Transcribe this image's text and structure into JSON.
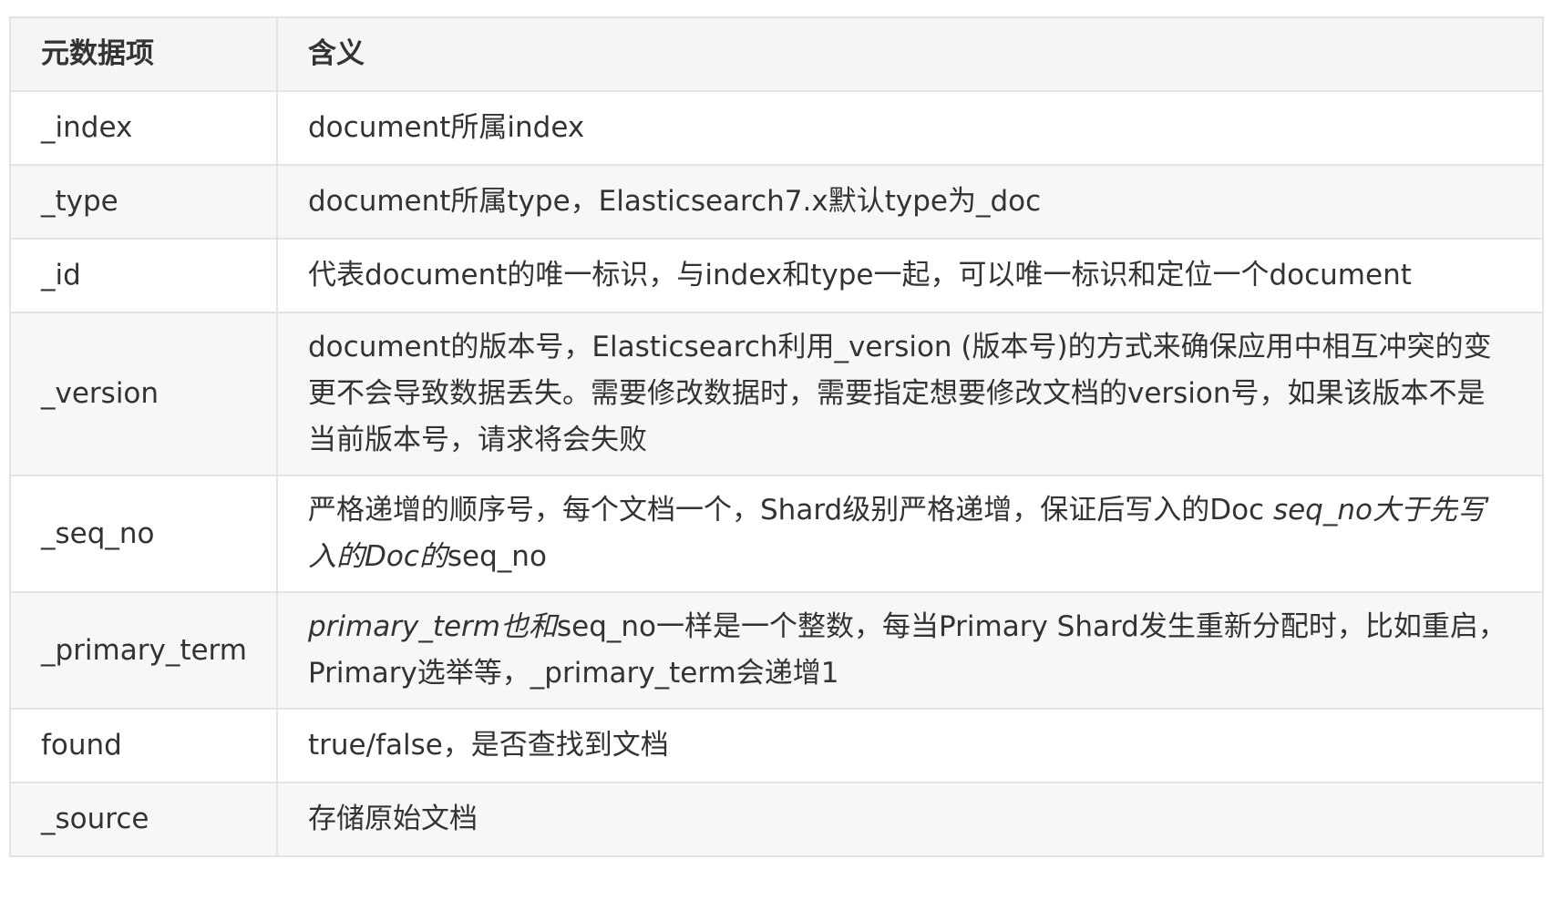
{
  "table": {
    "headers": [
      "元数据项",
      "含义"
    ],
    "rows": [
      {
        "key": "_index",
        "desc": [
          "document所属index"
        ]
      },
      {
        "key": "_type",
        "desc": [
          "document所属type，Elasticsearch7.x默认type为_doc"
        ]
      },
      {
        "key": "_id",
        "desc": [
          "代表document的唯一标识，与index和type一起，可以唯一标识和定位一个document"
        ]
      },
      {
        "key": "_version",
        "desc": [
          "document的版本号，Elasticsearch利用_version (版本号)的方式来确保应用中相互冲突的变更不会导致数据丢失。需要修改数据时，需要指定想要修改文档的version号，如果该版本不是当前版本号，请求将会失败"
        ]
      },
      {
        "key": "_seq_no",
        "desc_prefix": "严格递增的顺序号，每个文档一个，Shard级别严格递增，保证后写入的Doc ",
        "desc_italic": "seq_no大于先写入的Doc的",
        "desc_suffix": "seq_no"
      },
      {
        "key": "_primary_term",
        "desc_italic": "primary_term也和",
        "desc_suffix": "seq_no一样是一个整数，每当Primary Shard发生重新分配时，比如重启，Primary选举等，_primary_term会递增1"
      },
      {
        "key": "found",
        "desc": [
          "true/false，是否查找到文档"
        ]
      },
      {
        "key": "_source",
        "desc": [
          "存储原始文档"
        ]
      }
    ]
  }
}
